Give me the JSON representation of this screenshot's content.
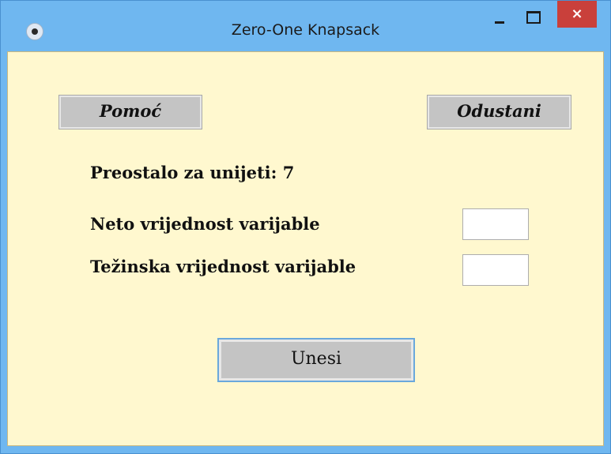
{
  "window": {
    "title": "Zero-One Knapsack",
    "close_label": "×"
  },
  "toolbar": {
    "help_label": "Pomoć",
    "cancel_label": "Odustani"
  },
  "form": {
    "remaining_label": "Preostalo za unijeti: 7",
    "net_value_label": "Neto vrijednost varijable",
    "net_value": "",
    "weight_value_label": "Težinska vrijednost varijable",
    "weight_value": "",
    "submit_label": "Unesi"
  },
  "colors": {
    "titlebar": "#6fb7f0",
    "client_background": "#fff8cf",
    "button_face": "#c4c4c4",
    "close_button": "#c9403b"
  }
}
